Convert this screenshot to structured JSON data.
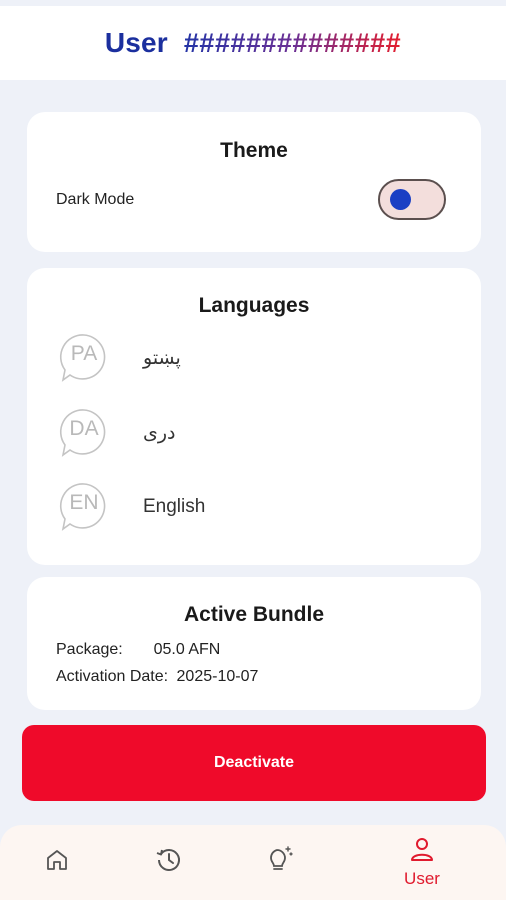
{
  "header": {
    "title": "User",
    "hash": "##############"
  },
  "theme": {
    "title": "Theme",
    "dark_mode_label": "Dark Mode"
  },
  "languages": {
    "title": "Languages",
    "items": [
      {
        "code": "PA",
        "name": "پښتو"
      },
      {
        "code": "DA",
        "name": "دری"
      },
      {
        "code": "EN",
        "name": "English"
      }
    ]
  },
  "bundle": {
    "title": "Active Bundle",
    "package_label": "Package:",
    "package_value": "05.0 AFN",
    "activation_label": "Activation Date:",
    "activation_value": "2025-10-07"
  },
  "actions": {
    "deactivate_label": "Deactivate"
  },
  "nav": {
    "items": [
      {
        "icon": "home-icon"
      },
      {
        "icon": "history-icon"
      },
      {
        "icon": "lightbulb-icon"
      },
      {
        "icon": "user-icon",
        "label": "User"
      }
    ]
  },
  "colors": {
    "brand_blue": "#1b2f9e",
    "accent_red": "#ef0a2a",
    "background": "#eef1f8"
  }
}
